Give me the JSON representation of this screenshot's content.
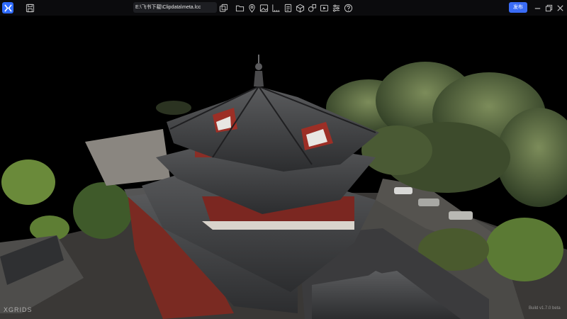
{
  "toolbar": {
    "file_path": "E:\\飞书下载\\Clipdata\\meta.lcc",
    "publish_label": "发布",
    "icons": [
      "save-icon",
      "layers-icon",
      "folder-icon",
      "location-pin-icon",
      "image-icon",
      "measure-icon",
      "document-icon",
      "cube-icon",
      "shapes-icon",
      "video-icon",
      "sliders-icon",
      "help-icon",
      "minimize-icon",
      "restore-icon",
      "close-icon"
    ]
  },
  "viewport": {
    "brand": "XGRIDS",
    "version": "Build v1.7.0 beta"
  }
}
